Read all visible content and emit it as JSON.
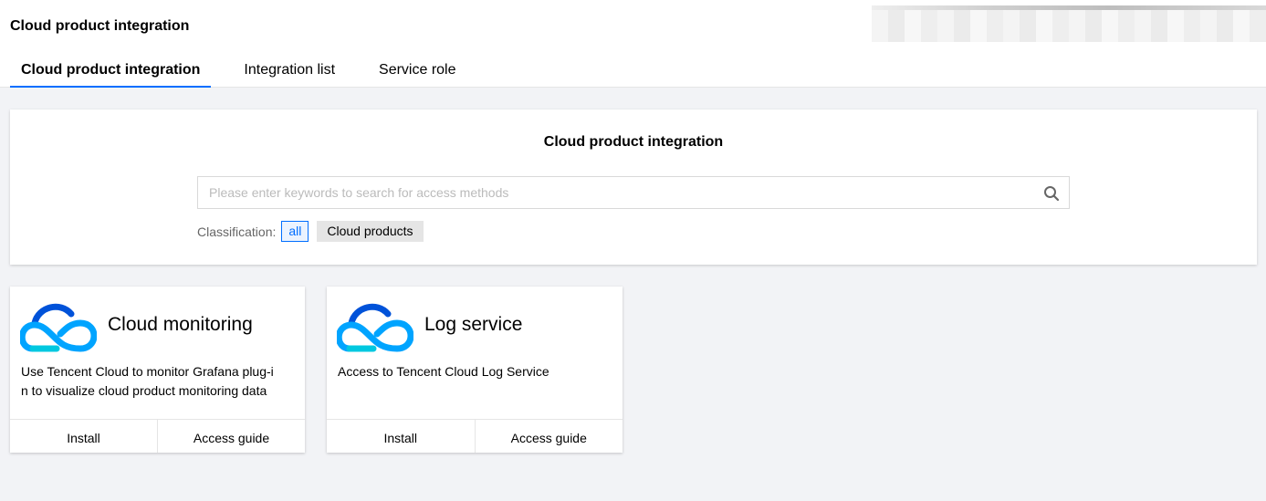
{
  "header": {
    "title": "Cloud product integration"
  },
  "tabs": [
    {
      "label": "Cloud product integration",
      "active": true
    },
    {
      "label": "Integration list",
      "active": false
    },
    {
      "label": "Service role",
      "active": false
    }
  ],
  "search_panel": {
    "title": "Cloud product integration",
    "placeholder": "Please enter keywords to search for access methods",
    "value": "",
    "classification_label": "Classification:",
    "chips": [
      {
        "label": "all",
        "active": true
      },
      {
        "label": "Cloud products",
        "active": false
      }
    ]
  },
  "cards": [
    {
      "title": "Cloud monitoring",
      "desc_line1": "Use Tencent Cloud to monitor Grafana plug-i",
      "desc_line2": "n to visualize cloud product monitoring data",
      "install_label": "Install",
      "guide_label": "Access guide",
      "icon": "tencent-cloud-logo-icon"
    },
    {
      "title": "Log service",
      "desc_line1": "Access to Tencent Cloud Log Service",
      "desc_line2": "",
      "install_label": "Install",
      "guide_label": "Access guide",
      "icon": "tencent-cloud-logo-icon"
    }
  ],
  "colors": {
    "accent": "#006eff",
    "background": "#f2f3f6",
    "logo_blue": "#0052d9",
    "logo_cyan": "#00a4ff"
  }
}
